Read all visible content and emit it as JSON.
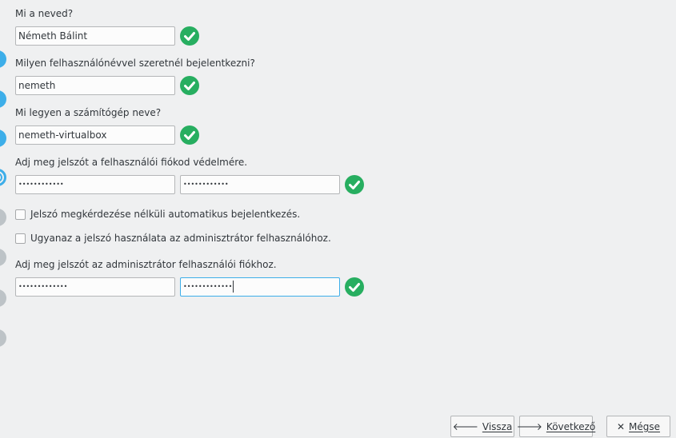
{
  "steps": [
    "done",
    "done",
    "done",
    "current",
    "todo",
    "todo",
    "todo",
    "todo"
  ],
  "name": {
    "label": "Mi a neved?",
    "value": "Németh Bálint"
  },
  "username": {
    "label": "Milyen felhasználónévvel szeretnél bejelentkezni?",
    "value": "nemeth"
  },
  "hostname": {
    "label": "Mi legyen a számítógép neve?",
    "value": "nemeth-virtualbox"
  },
  "user_password": {
    "label": "Adj meg jelszót a felhasználói fiókod védelmére.",
    "value": "••••••••••••",
    "confirm": "••••••••••••"
  },
  "autologin": {
    "label": "Jelszó megkérdezése nélküli automatikus bejelentkezés.",
    "checked": false
  },
  "reuse_password": {
    "label": "Ugyanaz a jelszó használata az adminisztrátor felhasználóhoz.",
    "checked": false
  },
  "admin_password": {
    "label": "Adj meg jelszót az adminisztrátor felhasználói fiókhoz.",
    "value": "•••••••••••••",
    "confirm": "•••••••••••••"
  },
  "buttons": {
    "back": {
      "icon": "arrow-left-icon",
      "label": "Vissza"
    },
    "next": {
      "icon": "arrow-right-icon",
      "label": "Következő"
    },
    "cancel": {
      "icon": "close-icon",
      "label": "Mégse"
    }
  },
  "colors": {
    "accent": "#3daee9",
    "ok": "#27ae60",
    "background": "#eff0f1"
  }
}
